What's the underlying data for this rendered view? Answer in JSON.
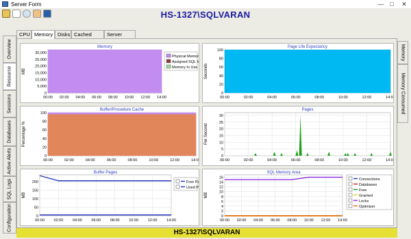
{
  "window": {
    "title": "Server Form",
    "minimize": "—",
    "maximize": "□",
    "close": "✕"
  },
  "header": {
    "banner": "HS-1327\\SQLVARAN"
  },
  "toolbar": {
    "icons": [
      "refresh-icon",
      "document-icon",
      "search-icon",
      "image-icon",
      "window-icon"
    ]
  },
  "tabs": [
    "CPU",
    "Memory",
    "Disks",
    "Cached Plans",
    "Server Waits"
  ],
  "active_tab": "Memory",
  "left_tabs": [
    "Overview",
    "Resource",
    "Sessions",
    "Databases",
    "Active Alerts",
    "SQL Logs",
    "Configuration"
  ],
  "active_left_tab": "Resource",
  "right_tabs": [
    "Memory",
    "Memory Consumed"
  ],
  "status_bar": {
    "text": "HS-1327\\SQLVARAN"
  },
  "colors": {
    "purple": "#c28cf0",
    "brown": "#8b3a3a",
    "cyan": "#00b8f2",
    "orange": "#e0865a",
    "green": "#18a018",
    "blue": "#2b3cc0",
    "banner": "#1a1aa0",
    "status": "#e5e033"
  },
  "chart_data": [
    {
      "type": "area",
      "title": "Memory",
      "ylabel": "MB",
      "xlabel": "",
      "x": [
        "00:00",
        "02:00",
        "04:00",
        "06:00",
        "08:00",
        "10:00",
        "12:00",
        "14:00"
      ],
      "ylim": [
        0,
        32000
      ],
      "yticks": [
        "0",
        "5,000",
        "10,000",
        "15,000",
        "20,000",
        "25,000",
        "30,000"
      ],
      "legend": "top-right",
      "series": [
        {
          "name": "Physical Memory",
          "color": "#c28cf0",
          "values": [
            32000,
            32000,
            32000,
            32000,
            32000,
            32000,
            32000,
            32000
          ]
        },
        {
          "name": "Assigned SQL Memory",
          "color": "#8b3a3a",
          "values": [
            2000,
            2000,
            2000,
            2000,
            2000,
            2000,
            2000,
            2000
          ]
        },
        {
          "name": "Memory In Use",
          "color": "#9fd89f",
          "values": [
            0,
            0,
            0,
            0,
            0,
            0,
            0,
            0
          ]
        }
      ]
    },
    {
      "type": "area",
      "title": "Page Life Expectancy",
      "ylabel": "Seconds",
      "xlabel": "",
      "x": [
        "00:00",
        "02:00",
        "04:00",
        "06:00",
        "08:00",
        "10:00",
        "12:00",
        "14:00"
      ],
      "ylim": [
        0,
        100
      ],
      "yticks": [
        "0",
        "20",
        "40",
        "60",
        "80",
        "100"
      ],
      "series": [
        {
          "name": "",
          "color": "#00b8f2",
          "values": [
            100,
            100,
            100,
            100,
            100,
            100,
            100,
            100
          ]
        }
      ]
    },
    {
      "type": "area",
      "title": "Buffer/Procedure Cache",
      "ylabel": "Percentage %",
      "xlabel": "",
      "x": [
        "00:00",
        "02:00",
        "04:00",
        "06:00",
        "08:00",
        "10:00",
        "12:00",
        "14:00"
      ],
      "ylim": [
        0,
        100
      ],
      "yticks": [
        "0",
        "20",
        "40",
        "60",
        "80",
        "100"
      ],
      "series": [
        {
          "name": "",
          "color": "#e0865a",
          "values": [
            96,
            96,
            96,
            96,
            96,
            96,
            96,
            96
          ]
        },
        {
          "name": "",
          "color": "#c28cf0",
          "values": [
            100,
            100,
            100,
            100,
            100,
            100,
            100,
            100
          ]
        }
      ]
    },
    {
      "type": "area",
      "title": "Pages",
      "ylabel": "Per Second",
      "xlabel": "",
      "x": [
        "00:00",
        "02:00",
        "04:00",
        "06:00",
        "08:00",
        "10:00",
        "12:00",
        "14:00"
      ],
      "ylim": [
        0,
        32
      ],
      "yticks": [
        "0",
        "5",
        "10",
        "15",
        "20",
        "25",
        "30"
      ],
      "series": [
        {
          "name": "",
          "color": "#18a018",
          "spikes": [
            [
              1.3,
              2
            ],
            [
              2.1,
              3
            ],
            [
              2.4,
              2
            ],
            [
              3.05,
              4
            ],
            [
              3.2,
              30
            ],
            [
              3.5,
              2
            ],
            [
              4.4,
              3
            ],
            [
              5.1,
              2
            ],
            [
              5.2,
              2
            ],
            [
              5.5,
              2
            ],
            [
              6.2,
              2
            ],
            [
              7.0,
              3
            ],
            [
              7.3,
              2
            ]
          ]
        }
      ]
    },
    {
      "type": "line",
      "title": "Buffer Pages",
      "ylabel": "MB",
      "xlabel": "",
      "x": [
        "00:00",
        "02:00",
        "04:00",
        "06:00",
        "08:00",
        "10:00",
        "12:00",
        "14:00"
      ],
      "ylim": [
        0,
        240
      ],
      "yticks": [
        "0",
        "50",
        "100",
        "150",
        "200"
      ],
      "legend": "top-right",
      "series": [
        {
          "name": "Free Pages",
          "color": "#2b3cc0",
          "values": [
            235,
            205,
            205,
            205,
            205,
            205,
            205,
            205
          ]
        },
        {
          "name": "Used Pages",
          "color": "#2b3cc0",
          "values": [
            5,
            5,
            5,
            5,
            5,
            5,
            5,
            5
          ]
        }
      ]
    },
    {
      "type": "line",
      "title": "SQL Memory Area",
      "ylabel": "MB",
      "xlabel": "",
      "x": [
        "00:00",
        "02:00",
        "04:00",
        "06:00",
        "08:00",
        "10:00",
        "12:00",
        "14:00"
      ],
      "ylim": [
        0,
        17
      ],
      "yticks": [
        "0",
        "2",
        "4",
        "6",
        "8",
        "10",
        "12",
        "14",
        "16"
      ],
      "legend": "right",
      "series": [
        {
          "name": "Connections",
          "color": "#2b3cc0",
          "values": [
            0,
            0,
            0,
            0,
            0,
            0,
            0,
            0
          ]
        },
        {
          "name": "Databases",
          "color": "#d02020",
          "values": [
            0,
            0,
            0,
            0,
            0,
            0,
            0,
            0
          ]
        },
        {
          "name": "Free",
          "color": "#18a018",
          "values": [
            0,
            0,
            0,
            0,
            0,
            0,
            0,
            0
          ]
        },
        {
          "name": "Granted",
          "color": "#e0d020",
          "values": [
            0,
            0,
            0,
            0,
            0,
            0,
            0,
            0
          ]
        },
        {
          "name": "Locks",
          "color": "#8a2be2",
          "values": [
            15,
            15,
            15,
            15,
            15,
            16,
            16,
            16
          ]
        },
        {
          "name": "Optimizer",
          "color": "#f07020",
          "values": [
            0,
            0,
            0,
            0,
            0,
            0,
            0,
            0
          ]
        }
      ]
    }
  ]
}
